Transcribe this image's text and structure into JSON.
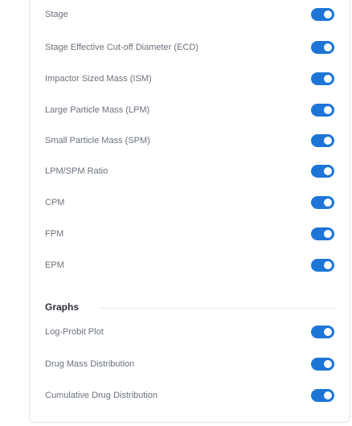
{
  "settings": {
    "items": [
      {
        "label": "Stage",
        "enabled": true
      },
      {
        "label": "Stage Effective Cut-off Diameter (ECD)",
        "enabled": true
      },
      {
        "label": "Impactor Sized Mass (ISM)",
        "enabled": true
      },
      {
        "label": "Large Particle Mass (LPM)",
        "enabled": true
      },
      {
        "label": "Small Particle Mass (SPM)",
        "enabled": true
      },
      {
        "label": "LPM/SPM Ratio",
        "enabled": true
      },
      {
        "label": "CPM",
        "enabled": true
      },
      {
        "label": "FPM",
        "enabled": true
      },
      {
        "label": "EPM",
        "enabled": true
      }
    ]
  },
  "graphs": {
    "title": "Graphs",
    "items": [
      {
        "label": "Log-Probit Plot",
        "enabled": true
      },
      {
        "label": "Drug Mass Distribution",
        "enabled": true
      },
      {
        "label": "Cumulative Drug Distribution",
        "enabled": true
      }
    ]
  },
  "colors": {
    "toggle_on": "#1e75d8",
    "label": "#6a727c",
    "heading": "#2b2f36"
  }
}
